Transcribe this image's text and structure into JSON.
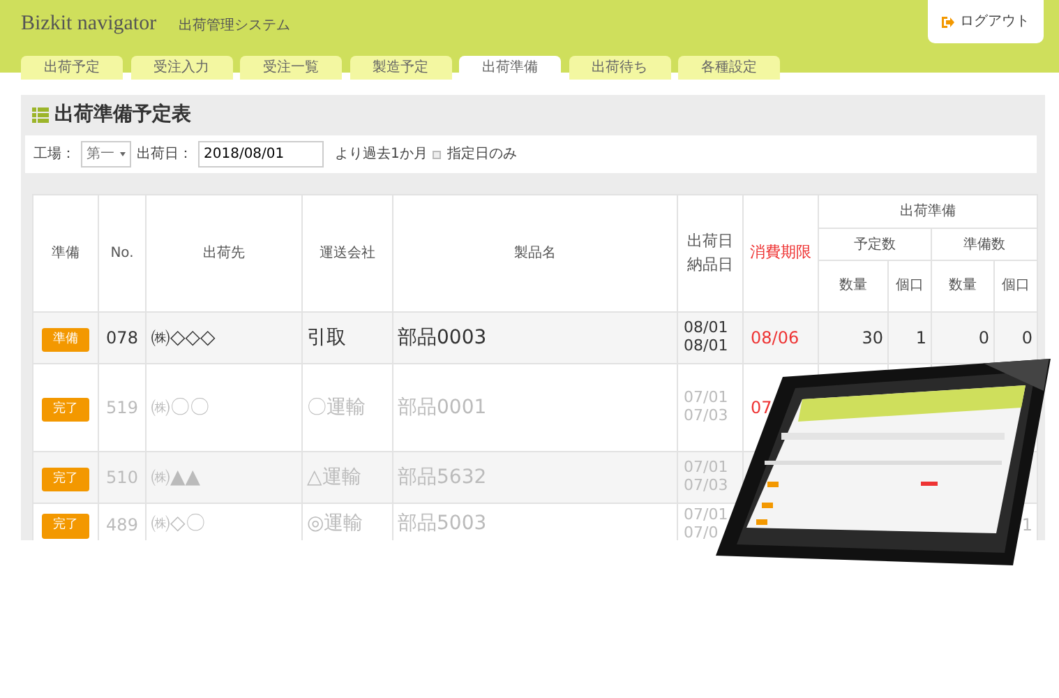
{
  "header": {
    "title": "Bizkit navigator",
    "subtitle": "出荷管理システム",
    "logout": "ログアウト"
  },
  "tabs": [
    {
      "label": "出荷予定",
      "selected": false
    },
    {
      "label": "受注入力",
      "selected": false
    },
    {
      "label": "受注一覧",
      "selected": false
    },
    {
      "label": "製造予定",
      "selected": false
    },
    {
      "label": "出荷準備",
      "selected": true
    },
    {
      "label": "出荷待ち",
      "selected": false
    },
    {
      "label": "各種設定",
      "selected": false
    }
  ],
  "panel": {
    "title": "出荷準備予定表"
  },
  "filter": {
    "factory_label": "工場：",
    "factory_value": "第一",
    "date_label": "出荷日：",
    "date_value": "2018/08/01",
    "range_text": "より過去1か月",
    "only_date": {
      "label": "指定日のみ",
      "checked": false
    }
  },
  "table": {
    "columns": [
      "準備",
      "No.",
      "出荷先",
      "運送会社",
      "製品名",
      "出荷日",
      "納品日",
      "消費期限",
      "出荷準備",
      "予定数",
      "準備数",
      "数量",
      "個口",
      "数量",
      "個口"
    ],
    "rows": [
      {
        "status": "準備",
        "completed": false,
        "no": "078",
        "destination": "㈱◇◇◇",
        "carrier": "引取",
        "product": "部品0003",
        "ship_date": "08/01",
        "delivery_date": "08/01",
        "expiry": "08/06",
        "plan_qty": "30",
        "plan_units": "1",
        "prep_qty": "0",
        "prep_units": "0"
      },
      {
        "status": "完了",
        "completed": true,
        "no": "519",
        "destination": "㈱〇〇",
        "carrier": "〇運輸",
        "product": "部品0001",
        "ship_date": "07/01",
        "delivery_date": "07/03",
        "expiry": "07"
      },
      {
        "status": "完了",
        "completed": true,
        "no": "510",
        "destination": "㈱▲▲",
        "carrier": "△運輸",
        "product": "部品5632",
        "ship_date": "07/01",
        "delivery_date": "07/03"
      },
      {
        "status": "完了",
        "completed": true,
        "no": "489",
        "destination": "㈱◇〇",
        "carrier": "◎運輸",
        "product": "部品5003",
        "ship_date": "07/01",
        "delivery_date": "07/0",
        "prep_units": "1"
      }
    ]
  }
}
